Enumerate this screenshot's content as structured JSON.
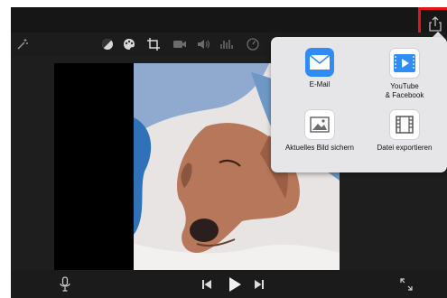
{
  "share_menu": {
    "items": [
      {
        "id": "mail",
        "label": "E-Mail",
        "icon": "mail-icon"
      },
      {
        "id": "youtube",
        "label": "YouTube\n& Facebook",
        "icon": "youtube-facebook-icon"
      },
      {
        "id": "save",
        "label": "Aktuelles Bild sichern",
        "icon": "photo-icon"
      },
      {
        "id": "export",
        "label": "Datei exportieren",
        "icon": "film-icon"
      }
    ]
  },
  "toolbar": {
    "icons": [
      "magic-wand-icon",
      "color-balance-icon",
      "palette-icon",
      "crop-icon",
      "camera-icon",
      "volume-icon",
      "equalizer-icon",
      "speed-icon"
    ]
  },
  "colors": {
    "accent_blue": "#2f8cf5",
    "highlight_red": "#e1151c"
  }
}
